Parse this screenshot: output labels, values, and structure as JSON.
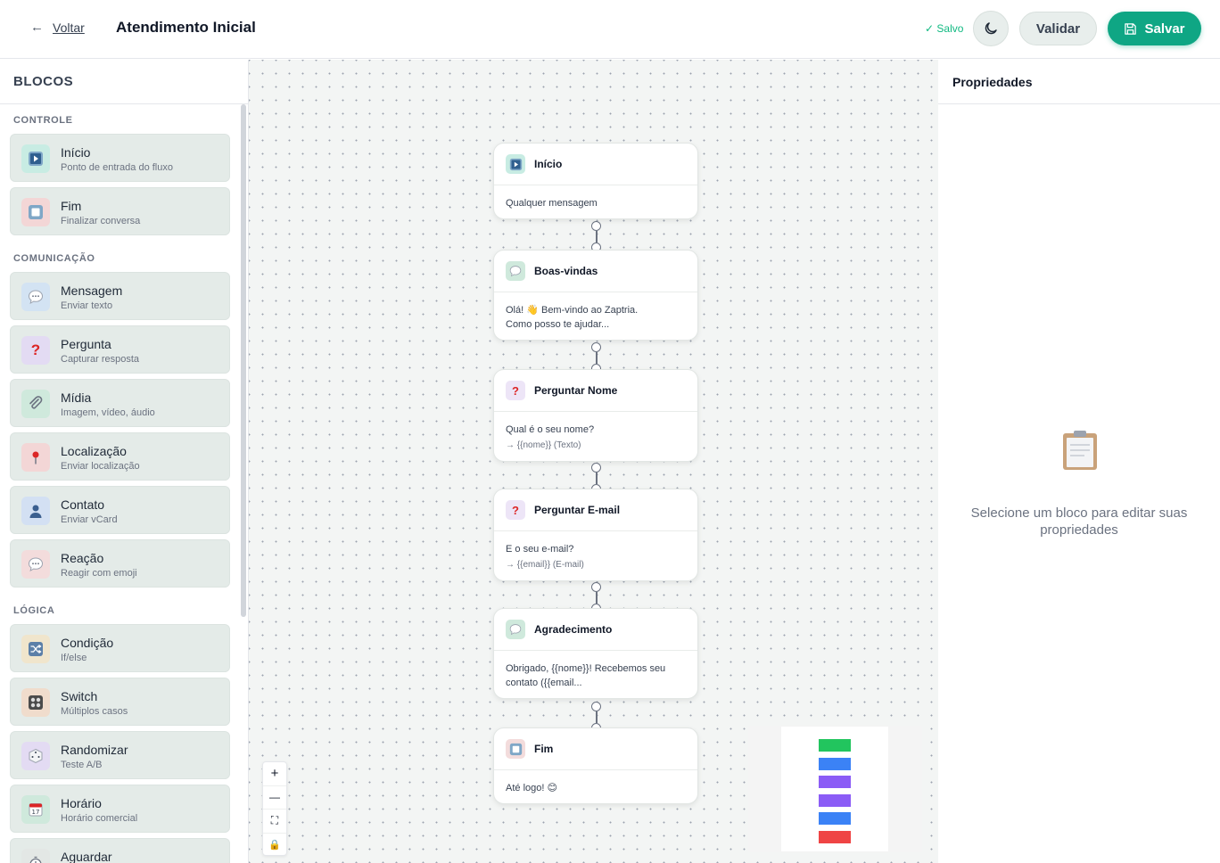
{
  "header": {
    "back_label": "Voltar",
    "title": "Atendimento Inicial",
    "saved_status": "✓ Salvo",
    "validate_label": "Validar",
    "save_label": "Salvar"
  },
  "sidebar": {
    "title": "BLOCOS",
    "sections": [
      {
        "title": "CONTROLE",
        "items": [
          {
            "name": "Início",
            "desc": "Ponto de entrada do fluxo",
            "icon": "play-icon"
          },
          {
            "name": "Fim",
            "desc": "Finalizar conversa",
            "icon": "stop-icon"
          }
        ]
      },
      {
        "title": "COMUNICAÇÃO",
        "items": [
          {
            "name": "Mensagem",
            "desc": "Enviar texto",
            "icon": "speech-bubble-icon"
          },
          {
            "name": "Pergunta",
            "desc": "Capturar resposta",
            "icon": "question-mark-icon"
          },
          {
            "name": "Mídia",
            "desc": "Imagem, vídeo, áudio",
            "icon": "paperclip-icon"
          },
          {
            "name": "Localização",
            "desc": "Enviar localização",
            "icon": "pin-icon"
          },
          {
            "name": "Contato",
            "desc": "Enviar vCard",
            "icon": "person-icon"
          },
          {
            "name": "Reação",
            "desc": "Reagir com emoji",
            "icon": "speech-bubble-icon"
          }
        ]
      },
      {
        "title": "LÓGICA",
        "items": [
          {
            "name": "Condição",
            "desc": "If/else",
            "icon": "shuffle-icon"
          },
          {
            "name": "Switch",
            "desc": "Múltiplos casos",
            "icon": "control-knobs-icon"
          },
          {
            "name": "Randomizar",
            "desc": "Teste A/B",
            "icon": "dice-icon"
          },
          {
            "name": "Horário",
            "desc": "Horário comercial",
            "icon": "calendar-icon"
          },
          {
            "name": "Aguardar",
            "desc": "",
            "icon": "stopwatch-icon"
          }
        ]
      }
    ]
  },
  "nodes": [
    {
      "title": "Início",
      "body": "Qualquer mensagem",
      "icon": "play-icon"
    },
    {
      "title": "Boas-vindas",
      "body": "Olá! 👋 Bem-vindo ao Zaptria.",
      "body2": "Como posso te ajudar...",
      "icon": "speech-bubble-icon"
    },
    {
      "title": "Perguntar Nome",
      "body": "Qual é o seu nome?",
      "var": "→ {{nome}} (Texto)",
      "icon": "question-mark-icon"
    },
    {
      "title": "Perguntar E-mail",
      "body": "E o seu e-mail?",
      "var": "→ {{email}} (E-mail)",
      "icon": "question-mark-icon"
    },
    {
      "title": "Agradecimento",
      "body": "Obrigado, {{nome}}! Recebemos seu",
      "body2": "contato ({{email...",
      "icon": "speech-bubble-icon"
    },
    {
      "title": "Fim",
      "body": "Até logo! 😊",
      "icon": "stop-icon"
    }
  ],
  "canvas_controls": {
    "zoom_in": "+",
    "zoom_out": "—",
    "fit": "⛶",
    "lock": "🔒"
  },
  "minimap_colors": [
    "#22c55e",
    "#3b82f6",
    "#8b5cf6",
    "#8b5cf6",
    "#3b82f6",
    "#ef4444"
  ],
  "properties": {
    "title": "Propriedades",
    "empty_message": "Selecione um bloco para editar suas propriedades"
  },
  "colors": {
    "accent": "#0fa684",
    "saved": "#10b981"
  }
}
